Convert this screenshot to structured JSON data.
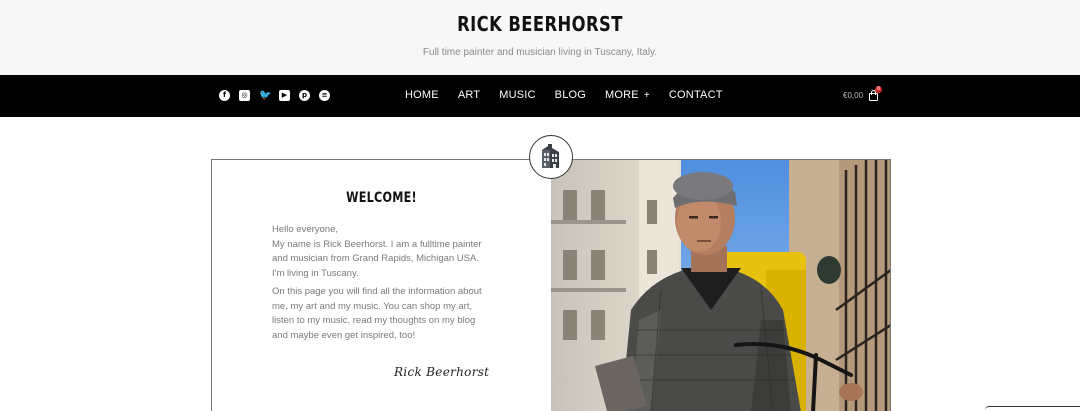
{
  "header": {
    "title": "RICK BEERHORST",
    "tagline": "Full time painter and musician living in Tuscany, Italy."
  },
  "social_icons": [
    "facebook-icon",
    "instagram-icon",
    "twitter-icon",
    "youtube-icon",
    "pinterest-icon",
    "spotify-icon"
  ],
  "nav": {
    "items": [
      {
        "label": "HOME"
      },
      {
        "label": "ART"
      },
      {
        "label": "MUSIC"
      },
      {
        "label": "BLOG"
      },
      {
        "label": "MORE"
      },
      {
        "label": "CONTACT"
      }
    ],
    "more_symbol": "+"
  },
  "cart": {
    "total": "€0,00",
    "count": "0"
  },
  "welcome": {
    "title": "WELCOME!",
    "para1": [
      "Hello everyone,",
      "My name is Rick Beerhorst. I am a fulltime painter",
      "and musician from Grand Rapids, Michigan USA.",
      "I'm living in Tuscany."
    ],
    "para2": [
      "On this page you will find all the information about",
      "me, my art and my music. You can shop my art,",
      "listen to my music, read my thoughts on my blog",
      "and maybe even get inspired, too!"
    ],
    "signature": "Rick Beerhorst"
  },
  "colors": {
    "nav_bg": "#000000",
    "header_bg": "#f7f7f7",
    "badge": "#d32f2f"
  }
}
